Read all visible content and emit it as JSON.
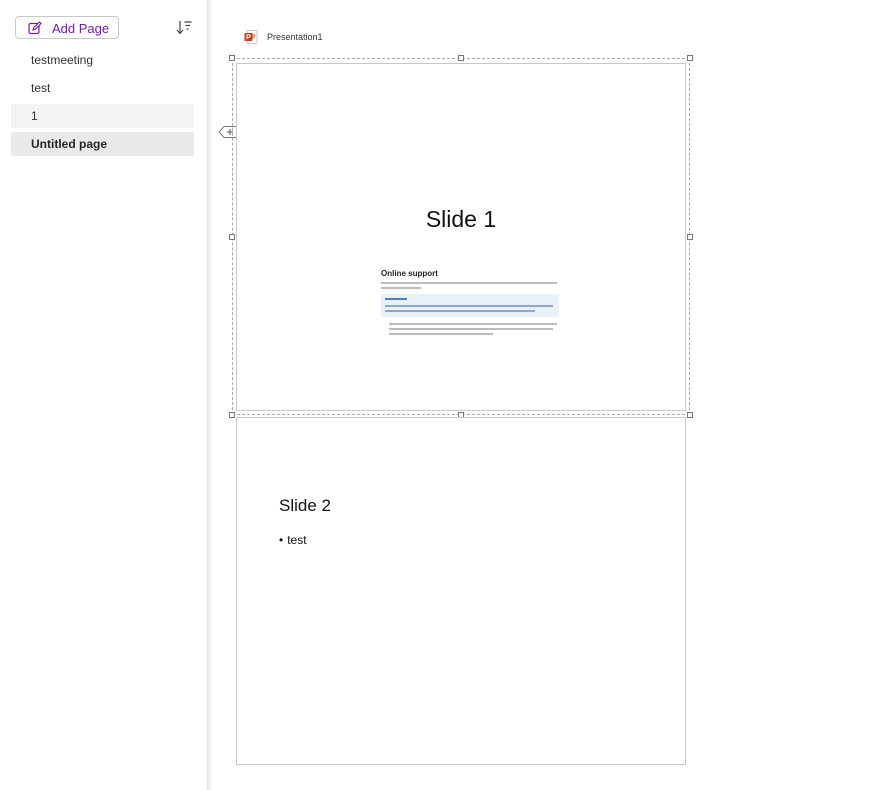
{
  "sidebar": {
    "add_page_label": "Add Page",
    "pages": [
      {
        "label": "testmeeting"
      },
      {
        "label": "test"
      },
      {
        "label": "1"
      },
      {
        "label": "Untitled page"
      }
    ],
    "selected_index": 3,
    "hover_index": 2,
    "icons": {
      "add_page": "compose-icon",
      "sort": "sort-descending-icon"
    }
  },
  "content": {
    "attachment": {
      "name": "Presentation1",
      "icon": "powerpoint-icon"
    },
    "slides": [
      {
        "title": "Slide 1",
        "embedded_image": {
          "heading": "Online support"
        }
      },
      {
        "title": "Slide 2",
        "bullets": [
          "test"
        ]
      }
    ]
  },
  "colors": {
    "accent": "#7719aa",
    "powerpoint": "#c43e1c",
    "selected_page_bg": "#e9e9e9",
    "hover_page_bg": "#f3f3f3"
  }
}
